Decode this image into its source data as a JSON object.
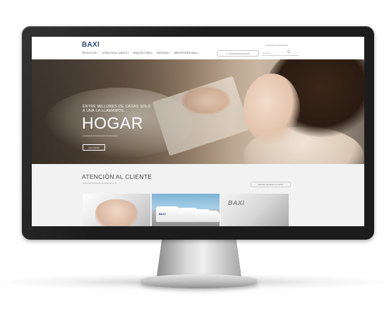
{
  "header": {
    "logo": "BAXI",
    "nav": [
      "PRODUCTOS ▾",
      "ATENCIÓN AL CLIENTE ▾",
      "ARQUITECTURA ▾",
      "ENERGÍAS ▾",
      "ÁREA PROFESIONAL ▾"
    ],
    "top_right": "◦ · xxxxxxxxxxxxxxxxxxxxx",
    "cta_button": "☺ XXXXXXXXXXXXXXX",
    "search_placeholder": "xxxxxxxxx"
  },
  "hero": {
    "subtitle_line1": "ENTRE MILLONES DE CASAS SOLO",
    "subtitle_line2": "A UNA LA LLAMAMOS...",
    "title": "HOGAR",
    "caption": "xxxxxxxxxx xxxxxxxxxxxxx xx xxxxxxxxx",
    "button": "xxxx xxxxxx"
  },
  "support": {
    "title": "ATENCIÓN AL CLIENTE",
    "subtitle": "xxxxxxxxx xxxxxxxxx xx xxxxxxxx xx xx",
    "link_button": "Xxxxxxx Xxxxxxxx xx xxxxxx",
    "card_van_logo": "BAXI",
    "card_sign": "BAXI"
  }
}
